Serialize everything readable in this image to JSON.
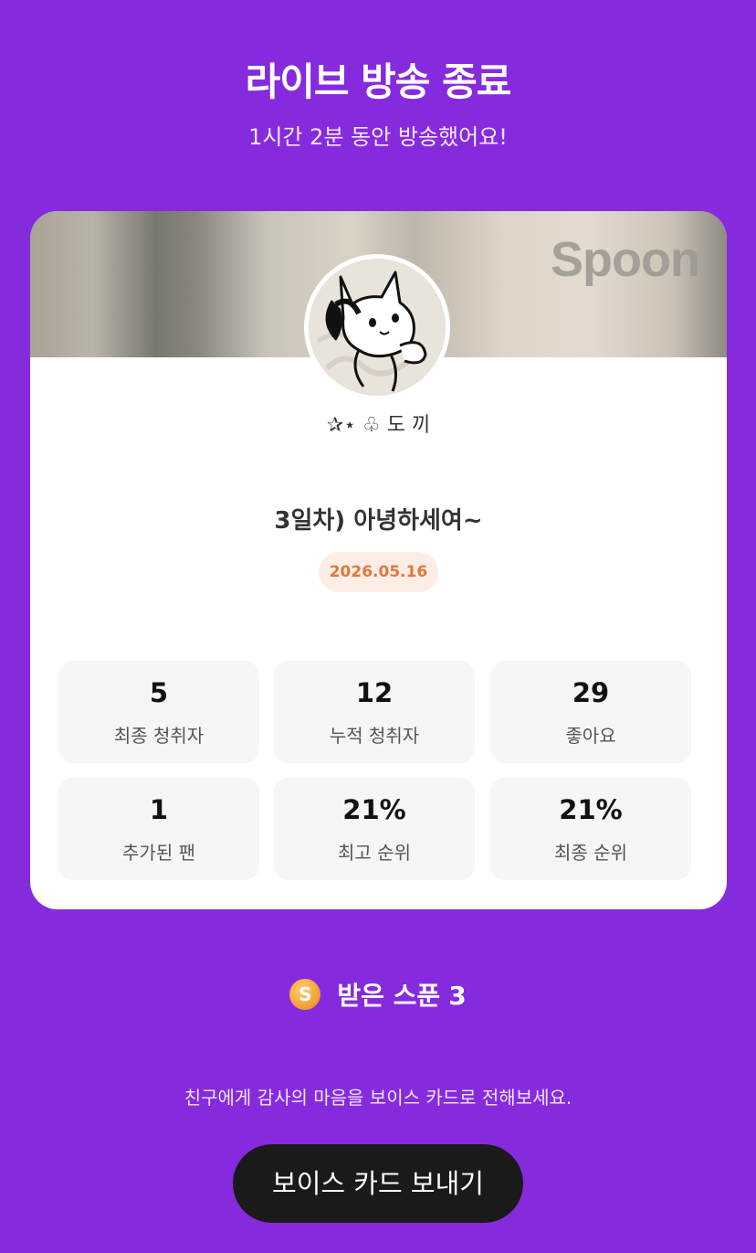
{
  "header": {
    "title": "라이브 방송 종료",
    "subtitle": "1시간 2분 동안 방송했어요!"
  },
  "card": {
    "brand": "Spoon",
    "nickname": "✰⋆ ♧ 도 끼",
    "live_title": "3일차) 아녕하세여~",
    "date": "2026.05.16",
    "stats": [
      {
        "value": "5",
        "label": "최종 청취자"
      },
      {
        "value": "12",
        "label": "누적 청취자"
      },
      {
        "value": "29",
        "label": "좋아요"
      },
      {
        "value": "1",
        "label": "추가된 팬"
      },
      {
        "value": "21%",
        "label": "최고 순위"
      },
      {
        "value": "21%",
        "label": "최종 순위"
      }
    ]
  },
  "spoons": {
    "coin_symbol": "S",
    "label": "받은 스푼",
    "count": "3"
  },
  "hint": "친구에게 감사의 마음을 보이스 카드로 전해보세요.",
  "cta_label": "보이스 카드 보내기",
  "colors": {
    "background": "#862ade",
    "card": "#ffffff",
    "date_badge_text": "#e0783f",
    "cta": "#1a1a1a"
  },
  "icons": {
    "coin": "spoon-coin-icon"
  }
}
